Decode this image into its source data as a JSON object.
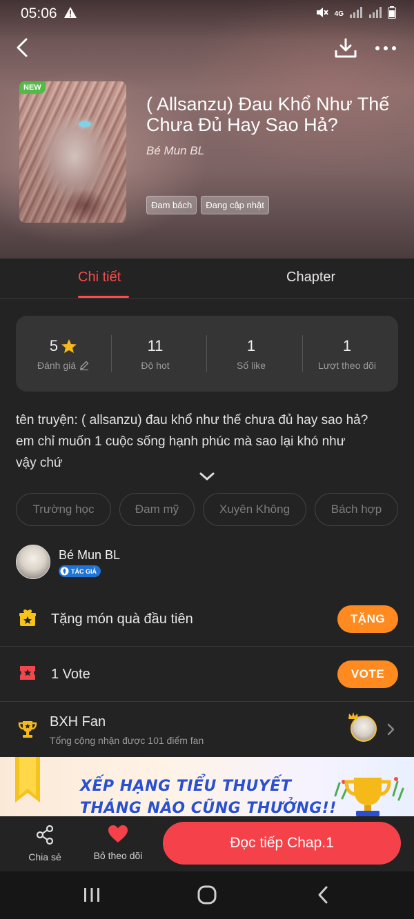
{
  "status_bar": {
    "time": "05:06",
    "network": "4G"
  },
  "header": {
    "back_icon": "chevron-left-icon",
    "download_icon": "download-icon",
    "more_icon": "more-dots-icon"
  },
  "story": {
    "new_badge": "NEW",
    "title": "( Allsanzu) Đau Khổ Như Thế Chưa Đủ Hay Sao Hả?",
    "author": "Bé Mun BL",
    "tags": [
      "Đam bách",
      "Đang cập nhật"
    ]
  },
  "tabs": [
    {
      "label": "Chi tiết",
      "active": true
    },
    {
      "label": "Chapter",
      "active": false
    }
  ],
  "stats": {
    "rating": {
      "value": "5",
      "label": "Đánh giá"
    },
    "hot": {
      "value": "11",
      "label": "Độ hot"
    },
    "likes": {
      "value": "1",
      "label": "Số like"
    },
    "followers": {
      "value": "1",
      "label": "Lượt theo dõi"
    }
  },
  "description": {
    "line1": "tên truyện: ( allsanzu) đau khổ như thế chưa đủ hay sao hả?",
    "line2": "em chỉ muốn 1 cuộc sống hạnh phúc mà sao lại khó như",
    "line3": "vậy chứ"
  },
  "genres": [
    "Trường học",
    "Đam mỹ",
    "Xuyên Không",
    "Bách hợp"
  ],
  "author_card": {
    "name": "Bé Mun BL",
    "badge": "TÁC GIẢ"
  },
  "gift_row": {
    "label": "Tặng món quà đầu tiên",
    "button": "TẶNG"
  },
  "vote_row": {
    "label": "1 Vote",
    "button": "VOTE"
  },
  "fan_row": {
    "title": "BXH Fan",
    "subtitle": "Tổng cộng nhận được 101 điểm fan"
  },
  "banner": {
    "line1": "XẾP HẠNG TIỂU THUYẾT",
    "line2": "THÁNG NÀO CŨNG THƯỞNG!!"
  },
  "bottom_bar": {
    "share_label": "Chia sẻ",
    "unfollow_label": "Bỏ theo dõi",
    "read_button": "Đọc tiếp Chap.1"
  },
  "colors": {
    "accent_red": "#ff4a4a",
    "accent_orange": "#ff8a1f",
    "read_button": "#f5424a",
    "background": "#232323"
  }
}
